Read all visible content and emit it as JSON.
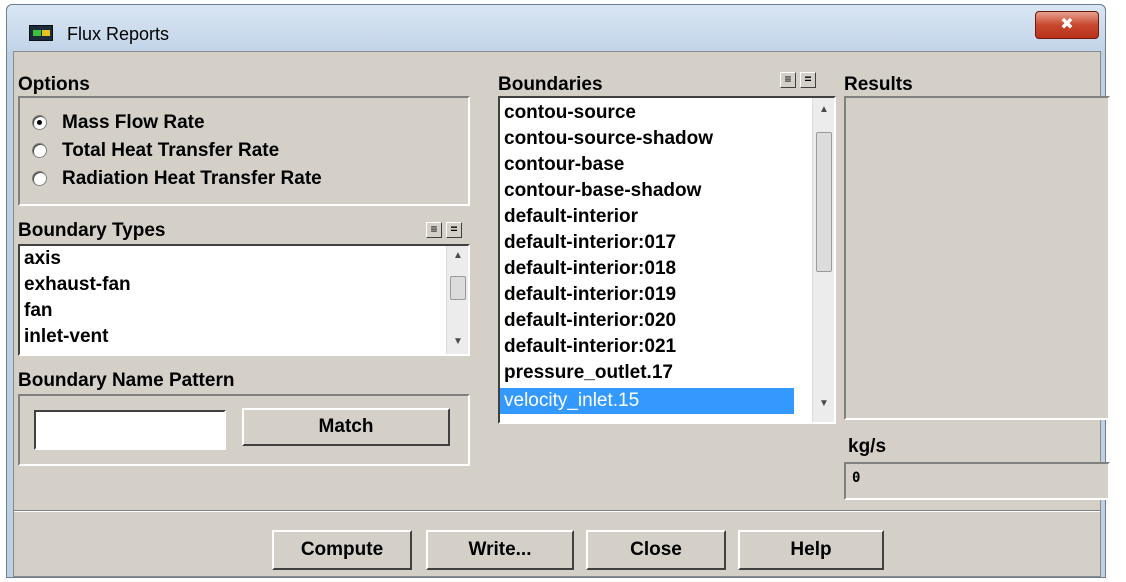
{
  "window": {
    "title": "Flux Reports",
    "close_glyph": "✖"
  },
  "options": {
    "label": "Options",
    "radios": [
      {
        "label": "Mass Flow Rate",
        "selected": true
      },
      {
        "label": "Total Heat Transfer Rate",
        "selected": false
      },
      {
        "label": "Radiation Heat Transfer Rate",
        "selected": false
      }
    ]
  },
  "boundary_types": {
    "label": "Boundary Types",
    "items": [
      "axis",
      "exhaust-fan",
      "fan",
      "inlet-vent"
    ],
    "select_all_glyph": "≡",
    "deselect_all_glyph": "="
  },
  "pattern": {
    "label": "Boundary Name Pattern",
    "value": "",
    "match_label": "Match"
  },
  "boundaries": {
    "label": "Boundaries",
    "select_all_glyph": "≡",
    "deselect_all_glyph": "=",
    "items": [
      "contou-source",
      "contou-source-shadow",
      "contour-base",
      "contour-base-shadow",
      "default-interior",
      "default-interior:017",
      "default-interior:018",
      "default-interior:019",
      "default-interior:020",
      "default-interior:021",
      "pressure_outlet.17",
      "velocity_inlet.15"
    ],
    "selected": "velocity_inlet.15"
  },
  "results": {
    "label": "Results",
    "units": "kg/s",
    "value": "0"
  },
  "buttons": {
    "compute": "Compute",
    "write": "Write...",
    "close": "Close",
    "help": "Help"
  },
  "colors": {
    "selection": "#3399ff",
    "dialog_bg": "#d4d0c8"
  }
}
